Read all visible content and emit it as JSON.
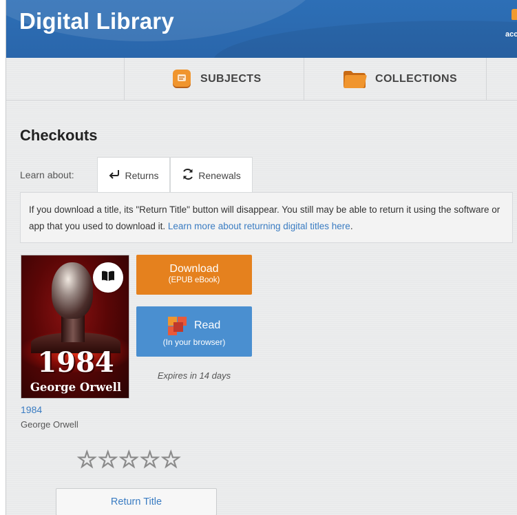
{
  "header": {
    "site_title": "Digital Library",
    "account_label": "acc"
  },
  "nav": {
    "items": [
      {
        "label": "SUBJECTS",
        "icon": "subjects-icon"
      },
      {
        "label": "COLLECTIONS",
        "icon": "folder-icon"
      }
    ]
  },
  "checkouts": {
    "title": "Checkouts",
    "learn_about_label": "Learn about:",
    "tabs": [
      {
        "label": "Returns",
        "icon": "return-arrow-icon"
      },
      {
        "label": "Renewals",
        "icon": "refresh-icon"
      }
    ],
    "info_text": "If you download a title, its \"Return Title\" button will disappear. You still may be able to return it using the software or app that you used to download it. ",
    "info_link": "Learn more about returning digital titles here",
    "info_end": "."
  },
  "book": {
    "cover_title": "1984",
    "cover_author": "George Orwell",
    "title": "1984",
    "author": "George Orwell",
    "format_badge_icon": "open-book-icon",
    "rating_stars": 0,
    "rating_max": 5,
    "expires": "Expires in 14 days"
  },
  "actions": {
    "download_label": "Download",
    "download_sub": "(EPUB eBook)",
    "read_label": "Read",
    "read_sub": "(In your browser)",
    "return_label": "Return Title"
  },
  "colors": {
    "header_blue": "#2d6fb6",
    "download_orange": "#e5811e",
    "read_blue": "#4a8fd0",
    "link_blue": "#3a7cc2"
  }
}
